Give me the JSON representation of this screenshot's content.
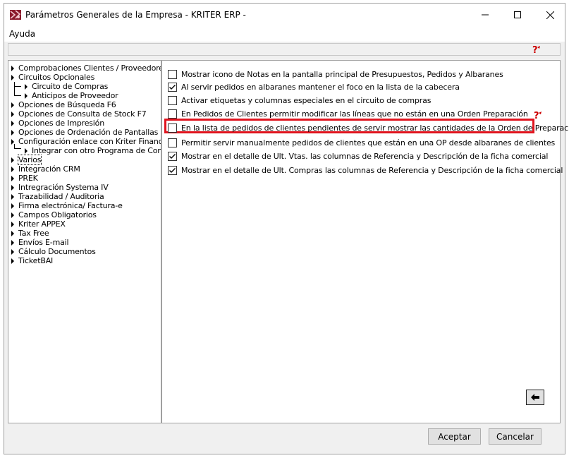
{
  "window": {
    "title": "Parámetros Generales de la Empresa - KRITER ERP -"
  },
  "menu": {
    "items": [
      "Ayuda"
    ]
  },
  "icons": {
    "help": "help-question-icon",
    "back": "back-arrow-icon",
    "tree_expander": "triangle-right-icon"
  },
  "colors": {
    "highlight": "#e0141e",
    "help_icon": "#cc0000"
  },
  "tree": {
    "items": [
      "Comprobaciones Clientes / Proveedores",
      "Circuitos Opcionales",
      "Circuito de Compras",
      "Anticipos de Proveedor",
      "Opciones de Búsqueda F6",
      "Opciones de Consulta de Stock F7",
      "Opciones de Impresión",
      "Opciones de Ordenación de Pantallas",
      "Configuración enlace con Kriter Finances",
      "Integrar con otro Programa de Contabi",
      "Varios",
      "Integración CRM",
      "PREK",
      "Intregración Systema IV",
      "Trazabilidad / Auditoria",
      "Firma electrónica/ Factura-e",
      "Campos Obligatorios",
      "Kriter APPEX",
      "Tax Free",
      "Envíos E-mail",
      "Cálculo Documentos",
      "TicketBAI"
    ],
    "selected": "Varios"
  },
  "options": [
    {
      "label": "Mostrar icono de Notas en la pantalla principal de Presupuestos, Pedidos y Albaranes",
      "checked": false
    },
    {
      "label": "Al servir pedidos en albaranes mantener el foco en la lista de la cabecera",
      "checked": true
    },
    {
      "label": "Activar etiquetas y columnas especiales en el circuito de compras",
      "checked": false
    },
    {
      "label": "En Pedidos de Clientes permitir modificar las líneas que no están en una Orden Preparación",
      "checked": false
    },
    {
      "label": "En la lista de pedidos de clientes pendientes de servir mostrar las cantidades de la Orden de Preparación",
      "checked": false,
      "highlighted": true
    },
    {
      "label": "Permitir servir manualmente pedidos de clientes que están en una OP desde albaranes de clientes",
      "checked": false
    },
    {
      "label": "Mostrar en el detalle de Ult. Vtas. las columnas de Referencia y Descripción de la ficha comercial",
      "checked": true
    },
    {
      "label": "Mostrar en el detalle de Ult. Compras las columnas de Referencia y Descripción de la ficha comercial",
      "checked": true
    }
  ],
  "buttons": {
    "accept": "Aceptar",
    "cancel": "Cancelar"
  }
}
